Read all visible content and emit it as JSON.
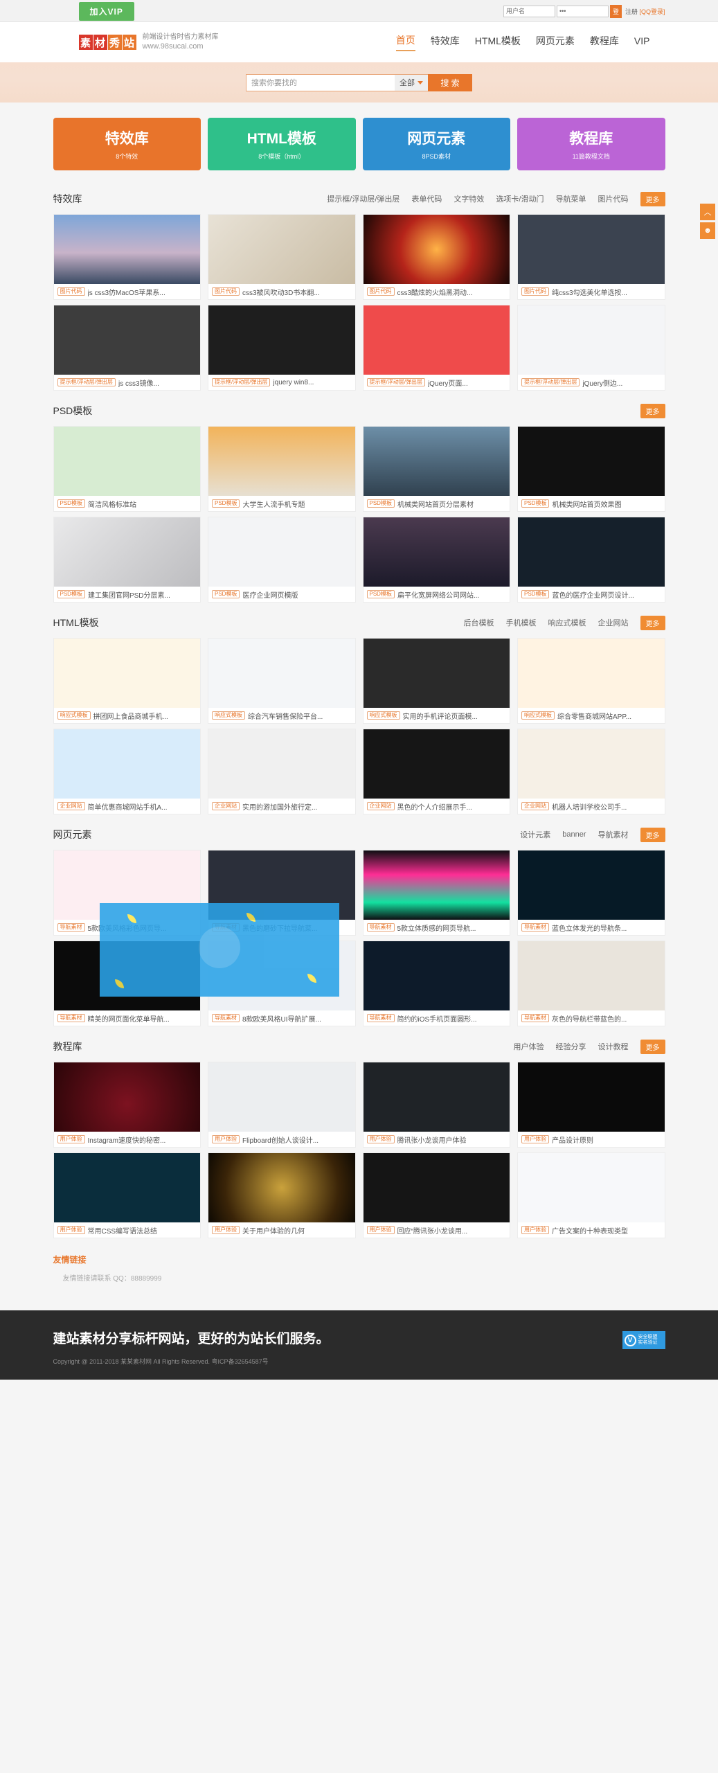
{
  "topbar": {
    "vip_label": "加入VIP",
    "username_placeholder": "用户名",
    "password_value": "•••",
    "login_button": "登",
    "register_link": "注册",
    "qq_login": "[QQ登录]"
  },
  "header": {
    "logo_chars": [
      "素",
      "材",
      "秀",
      "站"
    ],
    "slogan": "前端设计省时省力素材库",
    "site_url": "www.98sucai.com",
    "nav": [
      {
        "label": "首页",
        "active": true
      },
      {
        "label": "特效库",
        "active": false
      },
      {
        "label": "HTML模板",
        "active": false
      },
      {
        "label": "网页元素",
        "active": false
      },
      {
        "label": "教程库",
        "active": false
      },
      {
        "label": "VIP",
        "active": false
      }
    ]
  },
  "search": {
    "placeholder": "搜索你要找的",
    "scope_selected": "全部",
    "button_label": "搜 索"
  },
  "categories": [
    {
      "title": "特效库",
      "sub": "8个特效",
      "color": "#e8742b"
    },
    {
      "title": "HTML模板",
      "sub": "8个模板（html）",
      "color": "#2fc08a"
    },
    {
      "title": "网页元素",
      "sub": "8PSD素材",
      "color": "#2e8fd0"
    },
    {
      "title": "教程库",
      "sub": "11篇教程文档",
      "color": "#bb64d6"
    }
  ],
  "side_buttons": [
    {
      "name": "back-to-top",
      "glyph": "︿"
    },
    {
      "name": "customer-service",
      "glyph": "☻"
    }
  ],
  "sections": [
    {
      "title": "特效库",
      "links": [
        "提示框/浮动层/弹出层",
        "表单代码",
        "文字特效",
        "选项卡/滑动门",
        "导航菜单",
        "图片代码"
      ],
      "more": "更多",
      "rows": [
        [
          {
            "tag": "图片代码",
            "title": "js css3仿MacOS苹果系...",
            "art": "macos"
          },
          {
            "tag": "图片代码",
            "title": "css3被风吹动3D书本翻...",
            "art": "book"
          },
          {
            "tag": "图片代码",
            "title": "css3酷炫的火焰黑洞动...",
            "art": "flame"
          },
          {
            "tag": "图片代码",
            "title": "纯css3勾选美化单选按...",
            "art": "toggle"
          }
        ],
        [
          {
            "tag": "提示框/浮动层/弹出层",
            "title": "js css3镜像...",
            "art": "menudark"
          },
          {
            "tag": "提示框/浮动层/弹出层",
            "title": "jquery win8...",
            "art": "win8"
          },
          {
            "tag": "提示框/浮动层/弹出层",
            "title": "jQuery页面...",
            "art": "tenhover"
          },
          {
            "tag": "提示框/浮动层/弹出层",
            "title": "jQuery侧边...",
            "art": "sidebar"
          }
        ]
      ]
    },
    {
      "title": "PSD模板",
      "links": [],
      "more": "更多",
      "rows": [
        [
          {
            "tag": "PSD模板",
            "title": "简洁风格标准站",
            "art": "frogs"
          },
          {
            "tag": "PSD模板",
            "title": "大学生人流手机专题",
            "art": "weather"
          },
          {
            "tag": "PSD模板",
            "title": "机械类网站首页分层素材",
            "art": "mountain"
          },
          {
            "tag": "PSD模板",
            "title": "机械类网站首页效果图",
            "art": "blackui"
          }
        ],
        [
          {
            "tag": "PSD模板",
            "title": "建工集团官网PSD分层素...",
            "art": "greyarch"
          },
          {
            "tag": "PSD模板",
            "title": "医疗企业网页模版",
            "art": "medical"
          },
          {
            "tag": "PSD模板",
            "title": "扁平化宽屏网络公司网站...",
            "art": "darkgrid"
          },
          {
            "tag": "PSD模板",
            "title": "蓝色的医疗企业网页设计...",
            "art": "timer"
          }
        ]
      ]
    },
    {
      "title": "HTML模板",
      "links": [
        "后台模板",
        "手机模板",
        "响应式模板",
        "企业网站"
      ],
      "more": "更多",
      "rows": [
        [
          {
            "tag": "响应式模板",
            "title": "拼团网上食品商城手机...",
            "art": "food"
          },
          {
            "tag": "响应式模板",
            "title": "综合汽车销售保险平台...",
            "art": "carsale"
          },
          {
            "tag": "响应式模板",
            "title": "实用的手机评论页面模...",
            "art": "comment"
          },
          {
            "tag": "响应式模板",
            "title": "综合零售商城网站APP...",
            "art": "retail"
          }
        ],
        [
          {
            "tag": "企业网站",
            "title": "简单优惠商城网站手机A...",
            "art": "shopblue"
          },
          {
            "tag": "企业网站",
            "title": "实用的游加国外旅行定...",
            "art": "travel"
          },
          {
            "tag": "企业网站",
            "title": "黑色的个人介绍展示手...",
            "art": "blackcard"
          },
          {
            "tag": "企业网站",
            "title": "机器人培训学校公司手...",
            "art": "robot"
          }
        ]
      ]
    },
    {
      "title": "网页元素",
      "links": [
        "设计元素",
        "banner",
        "导航素材"
      ],
      "more": "更多",
      "rows": [
        [
          {
            "tag": "导航素材",
            "title": "5款欧美风格彩色网页导...",
            "art": "lotus"
          },
          {
            "tag": "导航素材",
            "title": "黑色的磨砂下拉导航菜...",
            "art": "darknav"
          },
          {
            "tag": "导航素材",
            "title": "5款立体质感的网页导航...",
            "art": "pinkcube"
          },
          {
            "tag": "导航素材",
            "title": "蓝色立体发光的导航条...",
            "art": "spiral"
          }
        ],
        [
          {
            "tag": "导航素材",
            "title": "精美的网页面化菜单导航...",
            "art": "mask"
          },
          {
            "tag": "导航素材",
            "title": "8款欧美风格UI导航扩展...",
            "art": "multi"
          },
          {
            "tag": "导航素材",
            "title": "简约的iOS手机页面圆形...",
            "art": "dots"
          },
          {
            "tag": "导航素材",
            "title": "灰色的导航栏带蓝色的...",
            "art": "coffee"
          }
        ]
      ]
    },
    {
      "title": "教程库",
      "links": [
        "用户体验",
        "经验分享",
        "设计教程"
      ],
      "more": "更多",
      "rows": [
        [
          {
            "tag": "用户体验",
            "title": "Instagram速度快的秘密...",
            "art": "redq"
          },
          {
            "tag": "用户体验",
            "title": "Flipboard创始人谈设计...",
            "art": "greynav"
          },
          {
            "tag": "用户体验",
            "title": "腾讯张小龙谈用户体验",
            "art": "clockwise"
          },
          {
            "tag": "用户体验",
            "title": "产品设计原则",
            "art": "oadi"
          }
        ],
        [
          {
            "tag": "用户体验",
            "title": "常用CSS编写语法总结",
            "art": "cyanwheel"
          },
          {
            "tag": "用户体验",
            "title": "关于用户体验的几何",
            "art": "goldsphere"
          },
          {
            "tag": "用户体验",
            "title": "回应“腾讯张小龙谈用...",
            "art": "gauge"
          },
          {
            "tag": "用户体验",
            "title": "广告文案的十种表现类型",
            "art": "uikit"
          }
        ]
      ]
    }
  ],
  "friend_links": {
    "title": "友情链接",
    "contact": "友情链接请联系 QQ：88889999"
  },
  "footer": {
    "slogan": "建站素材分享标杆网站，更好的为站长们服务。",
    "copyright": "Copyright @ 2011-2018 某某素材网 All Rights Reserved. 粤ICP备32654587号",
    "badge_line1": "安全联盟",
    "badge_line2": "实名验证",
    "badge_mark": "V"
  }
}
